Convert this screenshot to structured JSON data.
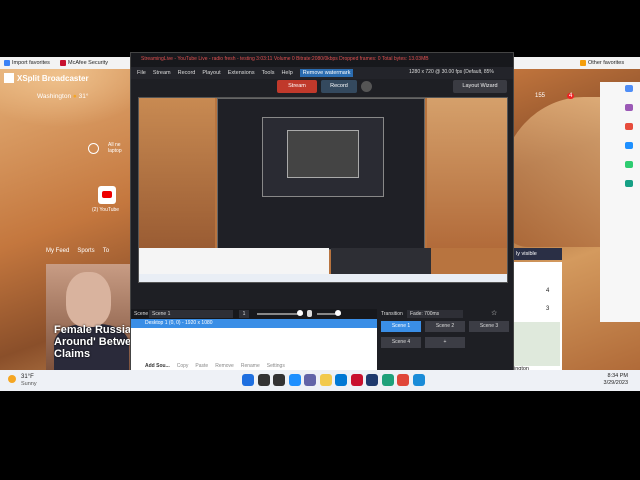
{
  "browser": {
    "favorites": [
      {
        "label": "Import favorites",
        "color": "#3b82f6"
      },
      {
        "label": "McAfee Security",
        "color": "#c8102e"
      },
      {
        "label": "Windows 7 reached end of...",
        "color": "#0ea5e9"
      },
      {
        "label": "Other favorites",
        "color": "#f59e0b"
      }
    ]
  },
  "msn": {
    "logo": "XSplit Broadcaster",
    "weather_location": "Washington",
    "weather_temp": "31°",
    "counter": "155",
    "notif": "4",
    "sidebar_text": "All ne laptop",
    "youtube_label": "(2) YouTube",
    "feed_tabs": [
      "My Feed",
      "Sports",
      "To"
    ],
    "headline": "Female Russia Around' Betwe Claims",
    "right_card_label": "ly visible",
    "right_card_nums": [
      "4",
      "3"
    ],
    "right_card_place": "ington"
  },
  "xsplit": {
    "title": "StreamingLive - YouTube Live - radio fresh - testing 3:03:11 Volume 0 Bitrate:2080/0kbps Dropped frames: 0 Total bytes: 13.03MB",
    "menu": [
      "File",
      "Stream",
      "Record",
      "Playout",
      "Extensions",
      "Tools",
      "Help"
    ],
    "watermark": "Remove watermark",
    "stream_btn": "Stream",
    "record_btn": "Record",
    "resolution": "1280 x 720 @ 30.00 fps (Default, 85%",
    "layout_btn": "Layout Wizard",
    "scene_label": "Scene",
    "scene_name": "Scene 1",
    "scene_num": "1",
    "source_item": "Desktop 1 (0, 0) - 1920 x 1080",
    "source_actions": [
      "Add Sou...",
      "Copy",
      "Paste",
      "Remove",
      "Rename",
      "Settings"
    ],
    "transition_label": "Transition",
    "transition_value": "Fade: 700ms",
    "scenes": [
      "Scene 1",
      "Scene 2",
      "Scene 3",
      "Scene 4",
      "+"
    ]
  },
  "taskbar": {
    "temp": "31°F",
    "condition": "Sunny",
    "time": "8:34 PM",
    "date": "3/29/2023",
    "icons": [
      {
        "name": "windows-start-icon",
        "color": "#1e6fe0"
      },
      {
        "name": "search-icon",
        "color": "#333333"
      },
      {
        "name": "task-view-icon",
        "color": "#333333"
      },
      {
        "name": "widgets-icon",
        "color": "#1e90ff"
      },
      {
        "name": "chat-icon",
        "color": "#6264a7"
      },
      {
        "name": "file-explorer-icon",
        "color": "#f2c94c"
      },
      {
        "name": "mail-icon",
        "color": "#0078d4"
      },
      {
        "name": "mcafee-icon",
        "color": "#c8102e"
      },
      {
        "name": "dell-icon",
        "color": "#1f3a6e"
      },
      {
        "name": "edge-icon",
        "color": "#1fa17a"
      },
      {
        "name": "chrome-icon",
        "color": "#e0473a"
      },
      {
        "name": "xsplit-icon",
        "color": "#1a8cd8"
      }
    ]
  }
}
